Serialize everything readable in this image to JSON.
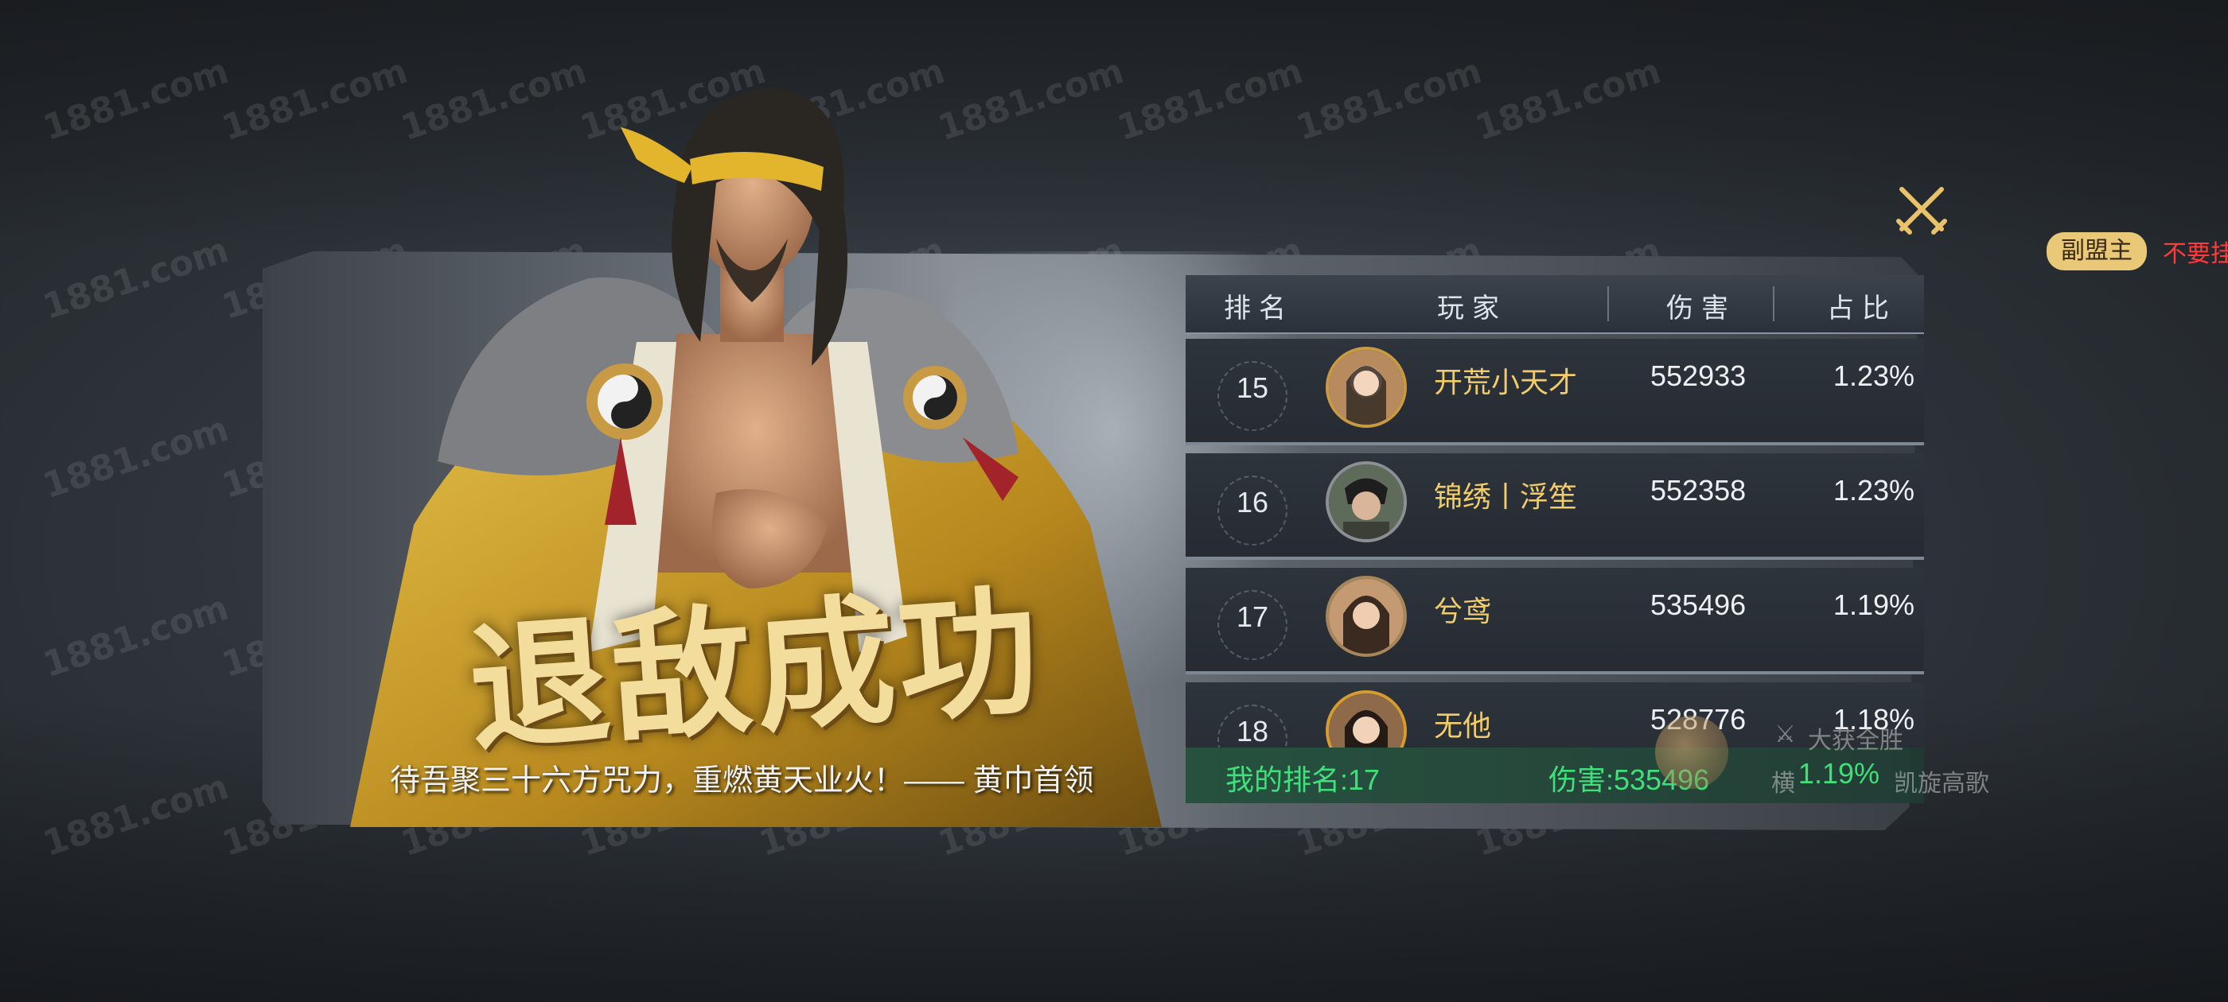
{
  "watermark": "1881.com",
  "banner": {
    "title": "退敌成功",
    "quote": "待吾聚三十六方咒力，重燃黄天业火！—— 黄巾首领"
  },
  "table": {
    "headers": {
      "rank": "排名",
      "player": "玩家",
      "damage": "伤害",
      "ratio": "占比"
    },
    "rows": [
      {
        "rank": "15",
        "name": "开荒小天才",
        "damage": "552933",
        "ratio": "1.23%"
      },
      {
        "rank": "16",
        "name": "锦绣丨浮笙",
        "damage": "552358",
        "ratio": "1.23%"
      },
      {
        "rank": "17",
        "name": "兮鸢",
        "damage": "535496",
        "ratio": "1.19%"
      },
      {
        "rank": "18",
        "name": "无他",
        "damage": "528776",
        "ratio": "1.18%"
      }
    ],
    "my": {
      "rank": "我的排名:17",
      "damage": "伤害:535496",
      "ratio": "1.19%"
    }
  },
  "side": {
    "role": "副盟主",
    "warning": "不要挂",
    "ghost_win": "大获全胜",
    "ghost_a": "横",
    "ghost_b": "凯旋高歌"
  },
  "colors": {
    "gold": "#f0cc6a",
    "green": "#3fe07a",
    "title": "#f3dd9c"
  }
}
